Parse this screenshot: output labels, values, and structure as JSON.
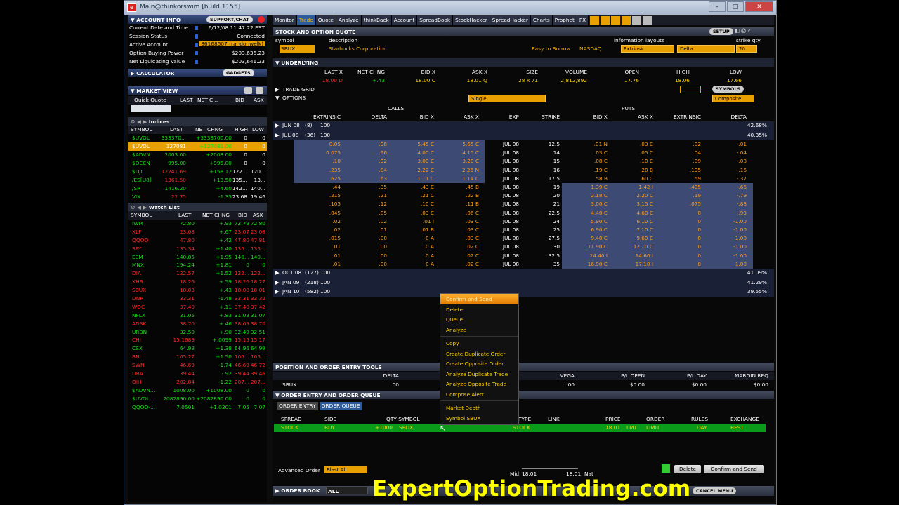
{
  "window": {
    "title": "Main@thinkorswim [build 1155]"
  },
  "left": {
    "account_info": {
      "title": "ACCOUNT INFO",
      "support_label": "SUPPORT/CHAT",
      "rows": [
        {
          "label": "Current Date and Time",
          "value": "6/12/08 11:47:22 EST"
        },
        {
          "label": "Session Status",
          "value": "Connected"
        },
        {
          "label": "Active Account",
          "value": "86168507 (randonwelk)"
        },
        {
          "label": "Option Buying Power",
          "value": "$203,636.23"
        },
        {
          "label": "Net Liquidating Value",
          "value": "$203,641.23"
        }
      ]
    },
    "calculator": {
      "title": "CALCULATOR",
      "gadgets_label": "GADGETS"
    },
    "market_view": {
      "title": "MARKET VIEW",
      "quick_quote": {
        "headers": [
          "Quick Quote",
          "LAST",
          "NET C...",
          "BID",
          "ASK"
        ]
      },
      "indices_label": "Indices",
      "indices_headers": [
        "SYMBOL",
        "LAST",
        "NET CHNG",
        "HIGH",
        "LOW"
      ],
      "indices": [
        {
          "sym": "$UVOL",
          "last": "333370...",
          "chg": "+3333700.00",
          "high": "0",
          "low": "0",
          "color": "grn"
        },
        {
          "sym": "$UVOL",
          "last": "127081",
          "chg": "+127081.00",
          "high": "0",
          "low": "0",
          "color": "hl"
        },
        {
          "sym": "$ADVN",
          "last": "2003.00",
          "chg": "+2003.00",
          "high": "0",
          "low": "0",
          "color": "grn"
        },
        {
          "sym": "$DECN",
          "last": "995.00",
          "chg": "+995.00",
          "high": "0",
          "low": "0",
          "color": "grn"
        },
        {
          "sym": "$DJI",
          "last": "12241.69",
          "chg": "+158.12",
          "high": "122...",
          "low": "120...",
          "color": "red"
        },
        {
          "sym": "/ES[U8]",
          "last": "1361.50",
          "chg": "+13.50",
          "high": "135...",
          "low": "13...",
          "color": "red"
        },
        {
          "sym": "/SP",
          "last": "1416.20",
          "chg": "+4.60",
          "high": "142...",
          "low": "140...",
          "color": "grn"
        },
        {
          "sym": "VIX",
          "last": "22.75",
          "chg": "-1.35",
          "high": "23.68",
          "low": "19.46",
          "color": "red"
        }
      ],
      "watchlist_label": "Watch List",
      "watch_headers": [
        "SYMBOL",
        "LAST",
        "NET CHNG",
        "BID",
        "ASK"
      ],
      "watchlist": [
        {
          "sym": "IWM",
          "last": "72.80",
          "chg": "+.93",
          "bid": "72.79",
          "ask": "72.80",
          "c": "grn"
        },
        {
          "sym": "XLF",
          "last": "23.08",
          "chg": "+.67",
          "bid": "23.07",
          "ask": "23.08",
          "c": "red"
        },
        {
          "sym": "QQQQ",
          "last": "47.80",
          "chg": "+.42",
          "bid": "47.80",
          "ask": "47.81",
          "c": "red"
        },
        {
          "sym": "SPY",
          "last": "135.34",
          "chg": "+1.40",
          "bid": "135...",
          "ask": "135...",
          "c": "red"
        },
        {
          "sym": "EEM",
          "last": "140.85",
          "chg": "+1.95",
          "bid": "140...",
          "ask": "140...",
          "c": "grn"
        },
        {
          "sym": "MNX",
          "last": "194.24",
          "chg": "+1.81",
          "bid": "0",
          "ask": "0",
          "c": "grn"
        },
        {
          "sym": "DIA",
          "last": "122.57",
          "chg": "+1.52",
          "bid": "122...",
          "ask": "122...",
          "c": "red"
        },
        {
          "sym": "XHB",
          "last": "18.26",
          "chg": "+.59",
          "bid": "18.26",
          "ask": "18.27",
          "c": "red"
        },
        {
          "sym": "SBUX",
          "last": "18.03",
          "chg": "+.43",
          "bid": "18.00",
          "ask": "18.01",
          "c": "red"
        },
        {
          "sym": "DNR",
          "last": "33.31",
          "chg": "-1.48",
          "bid": "33.31",
          "ask": "33.32",
          "c": "red"
        },
        {
          "sym": "WDC",
          "last": "37.40",
          "chg": "+.11",
          "bid": "37.40",
          "ask": "37.42",
          "c": "red"
        },
        {
          "sym": "NFLX",
          "last": "31.05",
          "chg": "+.83",
          "bid": "31.03",
          "ask": "31.07",
          "c": "grn"
        },
        {
          "sym": "ADSK",
          "last": "38.70",
          "chg": "+.46",
          "bid": "38.69",
          "ask": "38.70",
          "c": "red"
        },
        {
          "sym": "URBN",
          "last": "32.50",
          "chg": "+.90",
          "bid": "32.49",
          "ask": "32.51",
          "c": "grn"
        },
        {
          "sym": "CHI",
          "last": "15.1689",
          "chg": "+.0099",
          "bid": "15.15",
          "ask": "15.17",
          "c": "red"
        },
        {
          "sym": "CSX",
          "last": "64.98",
          "chg": "+1.38",
          "bid": "64.96",
          "ask": "64.99",
          "c": "grn"
        },
        {
          "sym": "BNI",
          "last": "105.27",
          "chg": "+1.50",
          "bid": "105...",
          "ask": "105...",
          "c": "red"
        },
        {
          "sym": "SWN",
          "last": "46.69",
          "chg": "-1.74",
          "bid": "46.69",
          "ask": "46.72",
          "c": "red"
        },
        {
          "sym": "DBA",
          "last": "39.44",
          "chg": "-.92",
          "bid": "39.44",
          "ask": "39.46",
          "c": "red"
        },
        {
          "sym": "OIH",
          "last": "202.84",
          "chg": "-1.22",
          "bid": "207...",
          "ask": "207...",
          "c": "red"
        },
        {
          "sym": "$ADVN...",
          "last": "1008.00",
          "chg": "+1008.00",
          "bid": "0",
          "ask": "0",
          "c": "grn"
        },
        {
          "sym": "$UVOL...",
          "last": "2082890.00",
          "chg": "+2082890.00",
          "bid": "0",
          "ask": "0",
          "c": "grn"
        },
        {
          "sym": "QQQQ-...",
          "last": "7.0501",
          "chg": "+1.0301",
          "bid": "7.05",
          "ask": "7.07",
          "c": "grn"
        }
      ]
    }
  },
  "main": {
    "tabs": [
      "Monitor",
      "Trade",
      "Quote",
      "Analyze",
      "thinkBack",
      "Account",
      "SpreadBook",
      "StockHacker",
      "SpreadHacker",
      "Charts",
      "Prophet",
      "FX"
    ],
    "active_tab": "Trade",
    "section_title": "STOCK AND OPTION QUOTE",
    "setup_label": "SETUP",
    "symbol_label": "symbol",
    "description_label": "description",
    "symbol_value": "SBUX",
    "description_value": "Starbucks Corporation",
    "easy_to_borrow": "Easy to Borrow",
    "exchange": "NASDAQ",
    "info_layouts_label": "information layouts",
    "strike_qty_label": "strike qty",
    "layout1": "Extrinsic",
    "layout2": "Delta",
    "strike_qty": "20",
    "underlying": {
      "label": "UNDERLYING",
      "headers": [
        "LAST X",
        "NET CHNG",
        "BID X",
        "ASK X",
        "SIZE",
        "VOLUME",
        "OPEN",
        "HIGH",
        "LOW"
      ],
      "values": [
        "18.00 D",
        "+.43",
        "18.00 C",
        "18.01 Q",
        "28 x 71",
        "2,812,892",
        "17.76",
        "18.06",
        "17.66"
      ]
    },
    "trade_grid_label": "TRADE GRID",
    "symbols_label": "SYMBOLS",
    "options_label": "OPTIONS",
    "options_type": "Single",
    "composite": "Composite",
    "calls_label": "CALLS",
    "puts_label": "PUTS",
    "option_headers": [
      "EXTRINSIC",
      "DELTA",
      "BID X",
      "ASK X",
      "EXP",
      "STRIKE",
      "BID X",
      "ASK X",
      "EXTRINSIC",
      "DELTA"
    ],
    "expiries_top": [
      {
        "label": "JUN 08",
        "days": "(8)",
        "count": "100",
        "iv": "42.68%"
      },
      {
        "label": "JUL 08",
        "days": "(36)",
        "count": "100",
        "iv": "40.35%"
      }
    ],
    "chain": [
      [
        "0.05",
        ".98",
        "5.45 C",
        "5.65 C",
        "JUL 08",
        "12.5",
        ".01 N",
        ".03 C",
        ".02",
        "-.01"
      ],
      [
        "0.075",
        ".96",
        "4.00 C",
        "4.15 C",
        "JUL 08",
        "14",
        ".03 C",
        ".05 C",
        ".04",
        "-.04"
      ],
      [
        ".10",
        ".92",
        "3.00 C",
        "3.20 C",
        "JUL 08",
        "15",
        ".08 C",
        ".10 C",
        ".09",
        "-.08"
      ],
      [
        ".235",
        ".84",
        "2.22 C",
        "2.25 N",
        "JUL 08",
        "16",
        ".19 C",
        ".20 B",
        ".195",
        "-.16"
      ],
      [
        ".625",
        ".63",
        "1.11 C",
        "1.14 C",
        "JUL 08",
        "17.5",
        ".58 B",
        ".60 C",
        ".59",
        "-.37"
      ],
      [
        ".44",
        ".35",
        ".43 C",
        ".45 B",
        "JUL 08",
        "19",
        "1.39 C",
        "1.42 I",
        ".405",
        "-.66"
      ],
      [
        ".215",
        ".21",
        ".21 C",
        ".22 B",
        "JUL 08",
        "20",
        "2.18 C",
        "2.20 C",
        ".19",
        "-.79"
      ],
      [
        ".105",
        ".12",
        ".10 C",
        ".11 B",
        "JUL 08",
        "21",
        "3.00 C",
        "3.15 C",
        ".075",
        "-.88"
      ],
      [
        ".045",
        ".05",
        ".03 C",
        ".06 C",
        "JUL 08",
        "22.5",
        "4.40 C",
        "4.60 C",
        "0",
        "-.93"
      ],
      [
        ".02",
        ".02",
        ".01 I",
        ".03 C",
        "JUL 08",
        "24",
        "5.90 C",
        "6.10 C",
        "0",
        "-1.00"
      ],
      [
        ".02",
        ".01",
        ".01 B",
        ".03 C",
        "JUL 08",
        "25",
        "6.90 C",
        "7.10 C",
        "0",
        "-1.00"
      ],
      [
        ".015",
        ".00",
        "0 A",
        ".03 C",
        "JUL 08",
        "27.5",
        "9.40 C",
        "9.60 C",
        "0",
        "-1.00"
      ],
      [
        ".01",
        ".00",
        "0 A",
        ".02 C",
        "JUL 08",
        "30",
        "11.90 C",
        "12.10 C",
        "0",
        "-1.00"
      ],
      [
        ".01",
        ".00",
        "0 A",
        ".02 C",
        "JUL 08",
        "32.5",
        "14.40 I",
        "14.60 I",
        "0",
        "-1.00"
      ],
      [
        ".01",
        ".00",
        "0 A",
        ".02 C",
        "JUL 08",
        "35",
        "16.90 C",
        "17.10 I",
        "0",
        "-1.00"
      ]
    ],
    "expiries_bottom": [
      {
        "label": "OCT 08",
        "days": "(127)",
        "count": "100",
        "iv": "41.09%"
      },
      {
        "label": "JAN 09",
        "days": "(218)",
        "count": "100",
        "iv": "41.29%"
      },
      {
        "label": "JAN 10",
        "days": "(582)",
        "count": "100",
        "iv": "39.55%"
      }
    ],
    "context_menu": [
      "Confirm and Send",
      "Delete",
      "Queue",
      "Analyze",
      "Copy",
      "Create Duplicate Order",
      "Create Opposite Order",
      "Analyze Duplicate Trade",
      "Analyze Opposite Trade",
      "Compose Alert",
      "Market Depth",
      "Symbol SBUX"
    ],
    "position": {
      "title": "POSITION AND ORDER ENTRY TOOLS",
      "headers": [
        "DELTA",
        "VEGA",
        "P/L OPEN",
        "P/L DAY",
        "MARGIN REQ"
      ],
      "symbol": "SBUX",
      "values": [
        ".00",
        ".00",
        "$0.00",
        "$0.00",
        "$0.00"
      ]
    },
    "order_entry": {
      "title": "ORDER ENTRY AND ORDER QUEUE",
      "tab1": "ORDER ENTRY",
      "tab2": "ORDER QUEUE",
      "headers": [
        "SPREAD",
        "SIDE",
        "QTY SYMBOL",
        "TYPE",
        "LINK",
        "PRICE",
        "ORDER",
        "RULES",
        "EXCHANGE"
      ],
      "values": [
        "STOCK",
        "BUY",
        "+1000",
        "SBUX",
        "STOCK",
        "18.01",
        "LMT",
        "LIMIT",
        "DAY",
        "BEST"
      ]
    },
    "advanced_order_label": "Advanced Order",
    "advanced_order_value": "Blast All",
    "mid_label": "Mid",
    "nat_label": "Nat",
    "price_left": "18.01",
    "price_right": "18.01",
    "delete_label": "Delete",
    "confirm_label": "Confirm and Send",
    "order_book_label": "ORDER BOOK",
    "order_book_filter": "ALL",
    "cancel_menu": "CANCEL MENU"
  },
  "watermark": "ExpertOptionTrading.com"
}
